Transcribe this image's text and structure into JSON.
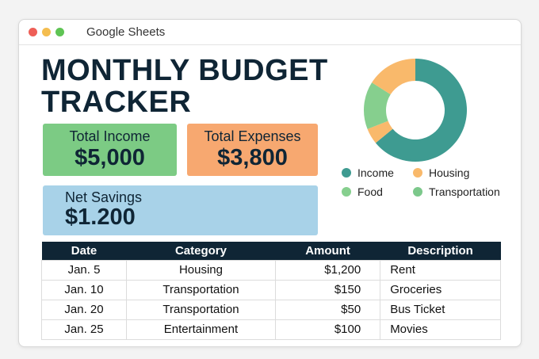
{
  "window": {
    "app_title": "Google Sheets",
    "controls": {
      "close": "#ee5f57",
      "minimize": "#f4bd4f",
      "maximize": "#5fc454"
    }
  },
  "title": {
    "line1": "MONTHLY BUDGET",
    "line2": "TRACKER"
  },
  "cards": {
    "income": {
      "label": "Total Income",
      "value": "$5,000"
    },
    "expenses": {
      "label": "Total Expenses",
      "value": "$3,800"
    },
    "savings": {
      "label": "Net Savings",
      "value": "$1.200"
    }
  },
  "chart_data": {
    "type": "pie",
    "segments": [
      {
        "name": "Income",
        "value": 64,
        "color": "#3e9b91"
      },
      {
        "name": "Housing",
        "value": 5,
        "color": "#f9b96b"
      },
      {
        "name": "Food",
        "value": 15,
        "color": "#86cf8e"
      },
      {
        "name": "Housing",
        "value": 16,
        "color": "#f9b96b"
      }
    ],
    "legend": [
      {
        "name": "Income",
        "color": "#3e9b91"
      },
      {
        "name": "Housing",
        "color": "#f9b96b"
      },
      {
        "name": "Food",
        "color": "#86cf8e"
      },
      {
        "name": "Transportation",
        "color": "#7cc88b"
      }
    ],
    "legend_placement": "bottom"
  },
  "table": {
    "headers": [
      "Date",
      "Category",
      "Amount",
      "Description"
    ],
    "rows": [
      [
        "Jan. 5",
        "Housing",
        "$1,200",
        "Rent"
      ],
      [
        "Jan. 10",
        "Transportation",
        "$150",
        "Groceries"
      ],
      [
        "Jan. 20",
        "Transportation",
        "$50",
        "Bus Ticket"
      ],
      [
        "Jan. 25",
        "Entertainment",
        "$100",
        "Movies"
      ]
    ]
  }
}
